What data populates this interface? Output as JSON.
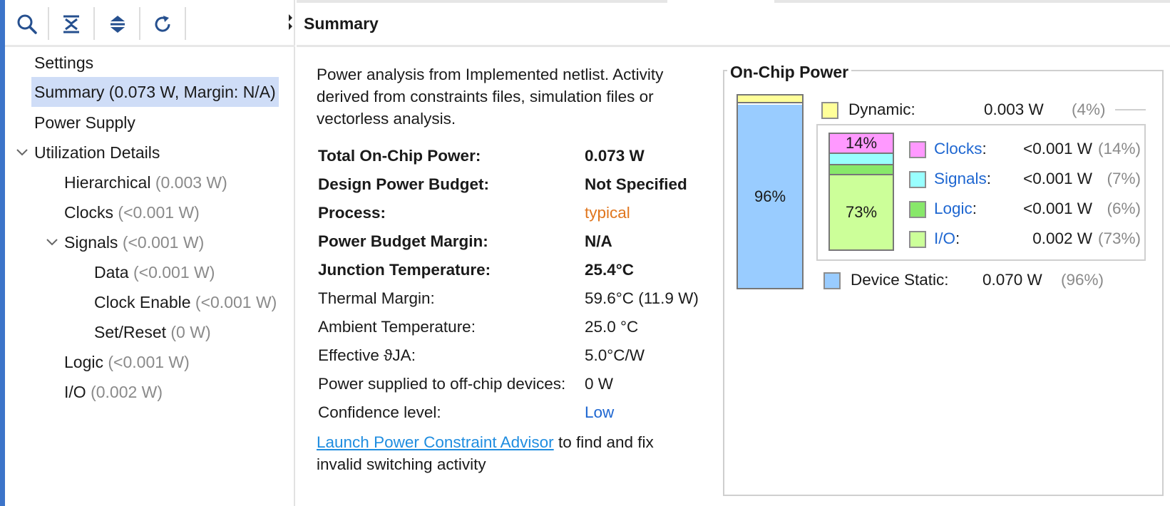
{
  "toolbar": {
    "buttons": [
      {
        "icon": "search-icon"
      },
      {
        "icon": "collapse-all-icon"
      },
      {
        "icon": "expand-all-icon"
      },
      {
        "icon": "refresh-icon"
      }
    ]
  },
  "tree": {
    "settings": "Settings",
    "summary": "Summary (0.073 W, Margin: N/A)",
    "power_supply": "Power Supply",
    "utilization": "Utilization Details",
    "hierarchical": {
      "label": "Hierarchical",
      "value": "(0.003 W)"
    },
    "clocks": {
      "label": "Clocks",
      "value": "(<0.001 W)"
    },
    "signals": {
      "label": "Signals",
      "value": "(<0.001 W)"
    },
    "data": {
      "label": "Data",
      "value": "(<0.001 W)"
    },
    "clock_enable": {
      "label": "Clock Enable",
      "value": "(<0.001 W)"
    },
    "set_reset": {
      "label": "Set/Reset",
      "value": "(0 W)"
    },
    "logic": {
      "label": "Logic",
      "value": "(<0.001 W)"
    },
    "io": {
      "label": "I/O",
      "value": "(0.002 W)"
    }
  },
  "header": {
    "title": "Summary"
  },
  "description": "Power analysis from Implemented netlist. Activity derived from constraints files, simulation files or vectorless analysis.",
  "summary": {
    "total_label": "Total On-Chip Power:",
    "total_value": "0.073 W",
    "budget_label": "Design Power Budget:",
    "budget_value": "Not Specified",
    "process_label": "Process:",
    "process_value": "typical",
    "margin_label": "Power Budget Margin:",
    "margin_value": "N/A",
    "junction_label": "Junction Temperature:",
    "junction_value": "25.4°C",
    "thermal_label": "Thermal Margin:",
    "thermal_value": "59.6°C (11.9 W)",
    "ambient_label": "Ambient Temperature:",
    "ambient_value": "25.0 °C",
    "theta_label": "Effective ϑJA:",
    "theta_value": "5.0°C/W",
    "offchip_label": "Power supplied to off-chip devices:",
    "offchip_value": "0 W",
    "confidence_label": "Confidence level:",
    "confidence_value": "Low"
  },
  "footer": {
    "link": "Launch Power Constraint Advisor",
    "text": " to find and fix invalid switching activity"
  },
  "onchip": {
    "title": "On-Chip Power",
    "main_bar": {
      "dynamic_fraction": 0.04,
      "static_fraction": 0.96,
      "static_label": "96%"
    },
    "dynamic": {
      "label": "Dynamic:",
      "value": "0.003 W",
      "pct": "(4%)",
      "color": "#ffff99"
    },
    "dyn_bar": {
      "clocks_label": "14%",
      "io_label": "73%"
    },
    "clocks": {
      "label": "Clocks",
      "colon": ":",
      "value": "<0.001 W",
      "pct": "(14%)",
      "color": "#ff99ff"
    },
    "signals": {
      "label": "Signals",
      "colon": ":",
      "value": "<0.001 W",
      "pct": "(7%)",
      "color": "#99ffff"
    },
    "logic": {
      "label": "Logic",
      "colon": ":",
      "value": "<0.001 W",
      "pct": "(6%)",
      "color": "#88e86a"
    },
    "io": {
      "label": "I/O",
      "colon": ":",
      "value": "0.002 W",
      "pct": "(73%)",
      "color": "#ccff99"
    },
    "static": {
      "label": "Device Static:",
      "value": "0.070 W",
      "pct": "(96%)",
      "color": "#99ccff"
    }
  }
}
